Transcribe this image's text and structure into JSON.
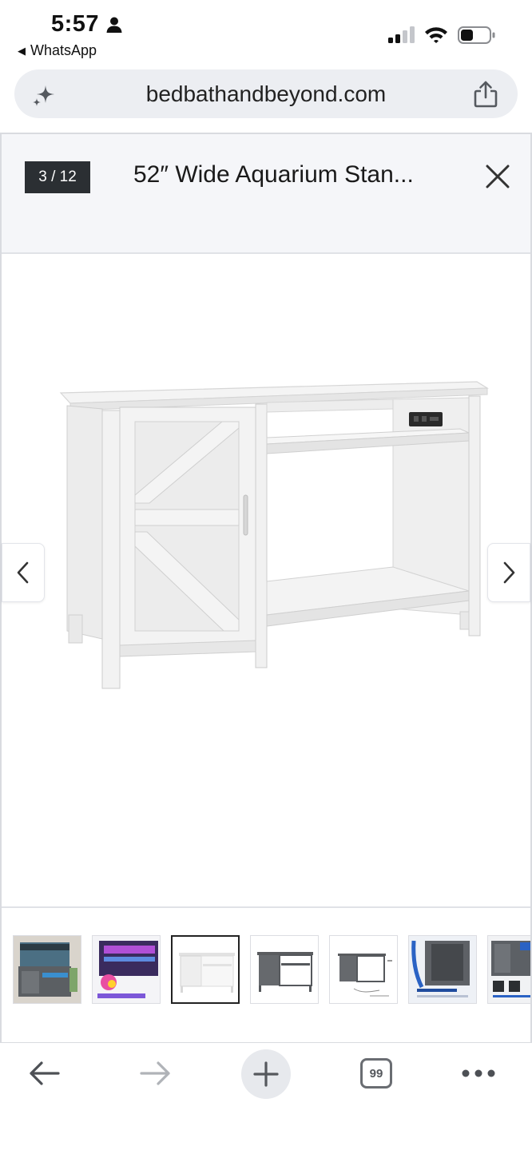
{
  "status_bar": {
    "time": "5:57",
    "back_app_label": "WhatsApp",
    "icons": [
      "person-icon",
      "signal-icon",
      "wifi-icon",
      "battery-icon"
    ]
  },
  "address_bar": {
    "url": "bedbathandbeyond.com",
    "left_icon": "sparkle-icon",
    "right_icon": "share-icon"
  },
  "gallery": {
    "counter": "3 / 12",
    "title": "52″ Wide Aquarium Stan...",
    "close_icon": "close-icon",
    "prev_icon": "chevron-left-icon",
    "next_icon": "chevron-right-icon",
    "selected_thumbnail": 3,
    "thumbnails_visible": 7
  },
  "toolbar": {
    "tab_count": "99",
    "icons": [
      "back-arrow-icon",
      "forward-arrow-icon",
      "plus-icon",
      "tabs-icon",
      "more-icon"
    ]
  },
  "colors": {
    "address_bar_bg": "#eceef2",
    "header_bg": "#f5f6f9",
    "counter_bg": "#2b2f33",
    "furniture_white": "#f2f2f2"
  }
}
